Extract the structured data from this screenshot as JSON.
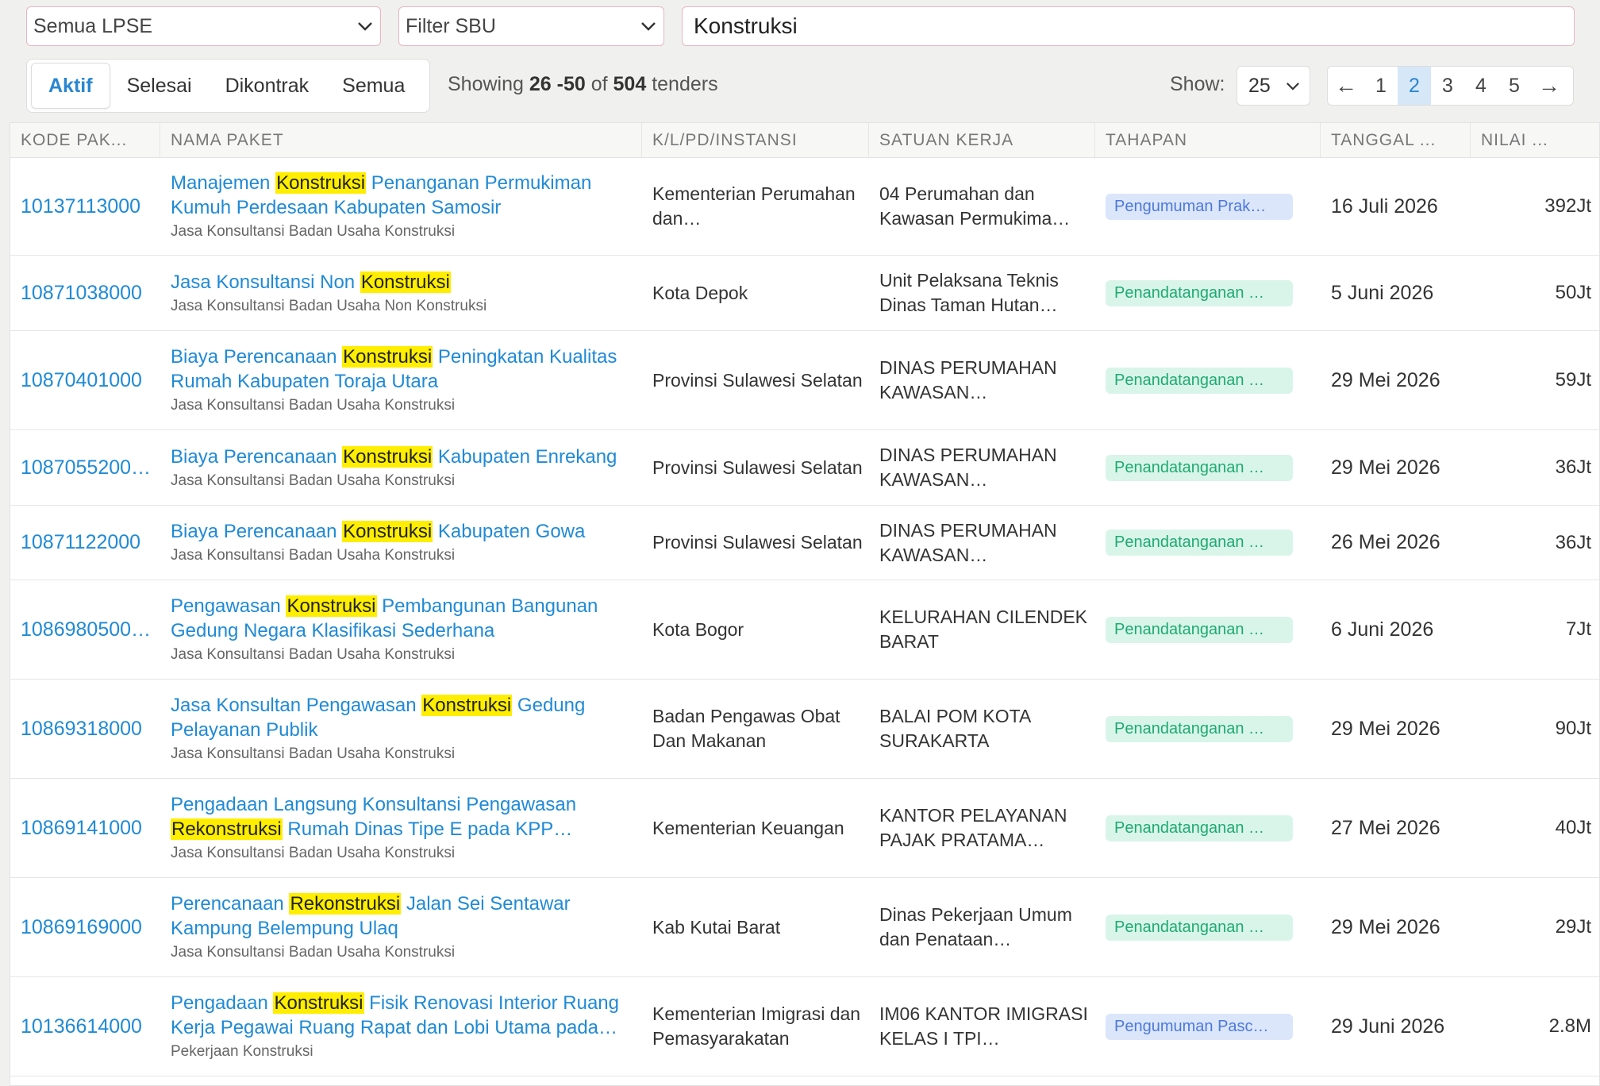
{
  "filters": {
    "lpse": "Semua LPSE",
    "sbu": "Filter SBU",
    "search": "Konstruksi"
  },
  "tabs": [
    {
      "label": "Aktif",
      "active": true
    },
    {
      "label": "Selesai",
      "active": false
    },
    {
      "label": "Dikontrak",
      "active": false
    },
    {
      "label": "Semua",
      "active": false
    }
  ],
  "showing": {
    "prefix": "Showing",
    "range": "26 -50",
    "of": "of",
    "total": "504",
    "suffix": "tenders"
  },
  "page_size": {
    "label": "Show:",
    "value": "25"
  },
  "pagination": {
    "prev": "←",
    "next": "→",
    "pages": [
      "1",
      "2",
      "3",
      "4",
      "5"
    ],
    "current": "2"
  },
  "columns": [
    "KODE PAK...",
    "NAMA PAKET",
    "K/L/PD/INSTANSI",
    "SATUAN KERJA",
    "TAHAPAN",
    "TANGGAL ...",
    "NILAI ..."
  ],
  "rows": [
    {
      "kode": "10137113000",
      "title_html": "Manajemen <mark>Konstruksi</mark> Penanganan Permukiman Kumuh Perdesaan Kabupaten Samosir",
      "sub": "Jasa Konsultansi Badan Usaha Konstruksi",
      "instansi": "Kementerian Perumahan dan…",
      "satker": "04 Perumahan dan Kawasan Permukima…",
      "tahapan": "Pengumuman Prak…",
      "tahapan_color": "blue",
      "tanggal": "16 Juli 2026",
      "nilai": "392Jt"
    },
    {
      "kode": "10871038000",
      "title_html": "Jasa Konsultansi Non <mark>Konstruksi</mark>",
      "sub": "Jasa Konsultansi Badan Usaha Non Konstruksi",
      "instansi": "Kota Depok",
      "satker": "Unit Pelaksana Teknis Dinas Taman Hutan…",
      "tahapan": "Penandatanganan …",
      "tahapan_color": "green",
      "tanggal": "5 Juni 2026",
      "nilai": "50Jt"
    },
    {
      "kode": "10870401000",
      "title_html": "Biaya Perencanaan <mark>Konstruksi</mark> Peningkatan Kualitas Rumah Kabupaten Toraja Utara",
      "sub": "Jasa Konsultansi Badan Usaha Konstruksi",
      "instansi": "Provinsi Sulawesi Selatan",
      "satker": "DINAS PERUMAHAN KAWASAN…",
      "tahapan": "Penandatanganan …",
      "tahapan_color": "green",
      "tanggal": "29 Mei 2026",
      "nilai": "59Jt"
    },
    {
      "kode": "1087055200…",
      "title_html": "Biaya Perencanaan <mark>Konstruksi</mark> Kabupaten Enrekang",
      "sub": "Jasa Konsultansi Badan Usaha Konstruksi",
      "instansi": "Provinsi Sulawesi Selatan",
      "satker": "DINAS PERUMAHAN KAWASAN…",
      "tahapan": "Penandatanganan …",
      "tahapan_color": "green",
      "tanggal": "29 Mei 2026",
      "nilai": "36Jt"
    },
    {
      "kode": "10871122000",
      "title_html": "Biaya Perencanaan <mark>Konstruksi</mark> Kabupaten Gowa",
      "sub": "Jasa Konsultansi Badan Usaha Konstruksi",
      "instansi": "Provinsi Sulawesi Selatan",
      "satker": "DINAS PERUMAHAN KAWASAN…",
      "tahapan": "Penandatanganan …",
      "tahapan_color": "green",
      "tanggal": "26 Mei 2026",
      "nilai": "36Jt"
    },
    {
      "kode": "1086980500…",
      "title_html": "Pengawasan <mark>Konstruksi</mark> Pembangunan Bangunan Gedung Negara Klasifikasi Sederhana",
      "sub": "Jasa Konsultansi Badan Usaha Konstruksi",
      "instansi": "Kota Bogor",
      "satker": "KELURAHAN CILENDEK BARAT",
      "tahapan": "Penandatanganan …",
      "tahapan_color": "green",
      "tanggal": "6 Juni 2026",
      "nilai": "7Jt"
    },
    {
      "kode": "10869318000",
      "title_html": "Jasa Konsultan Pengawasan <mark>Konstruksi</mark> Gedung Pelayanan Publik",
      "sub": "Jasa Konsultansi Badan Usaha Konstruksi",
      "instansi": "Badan Pengawas Obat Dan Makanan",
      "satker": "BALAI POM KOTA SURAKARTA",
      "tahapan": "Penandatanganan …",
      "tahapan_color": "green",
      "tanggal": "29 Mei 2026",
      "nilai": "90Jt"
    },
    {
      "kode": "10869141000",
      "title_html": "Pengadaan Langsung Konsultansi Pengawasan <mark>Rekonstruksi</mark> Rumah Dinas Tipe E pada KPP…",
      "sub": "Jasa Konsultansi Badan Usaha Konstruksi",
      "instansi": "Kementerian Keuangan",
      "satker": "KANTOR PELAYANAN PAJAK PRATAMA…",
      "tahapan": "Penandatanganan …",
      "tahapan_color": "green",
      "tanggal": "27 Mei 2026",
      "nilai": "40Jt"
    },
    {
      "kode": "10869169000",
      "title_html": "Perencanaan <mark>Rekonstruksi</mark> Jalan Sei Sentawar Kampung Belempung Ulaq",
      "sub": "Jasa Konsultansi Badan Usaha Konstruksi",
      "instansi": "Kab Kutai Barat",
      "satker": "Dinas Pekerjaan Umum dan Penataan…",
      "tahapan": "Penandatanganan …",
      "tahapan_color": "green",
      "tanggal": "29 Mei 2026",
      "nilai": "29Jt"
    },
    {
      "kode": "10136614000",
      "title_html": "Pengadaan <mark>Konstruksi</mark> Fisik Renovasi Interior Ruang Kerja Pegawai Ruang Rapat dan Lobi Utama pada…",
      "sub": "Pekerjaan Konstruksi",
      "instansi": "Kementerian Imigrasi dan Pemasyarakatan",
      "satker": "IM06 KANTOR IMIGRASI KELAS I TPI…",
      "tahapan": "Pengumuman Pasc…",
      "tahapan_color": "blue",
      "tanggal": "29 Juni 2026",
      "nilai": "2.8M"
    }
  ]
}
